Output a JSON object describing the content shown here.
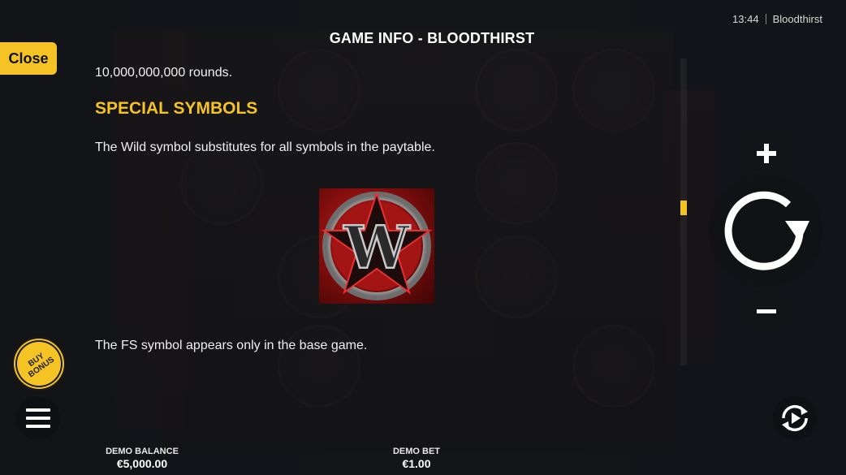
{
  "status_bar": {
    "time": "13:44",
    "game_name": "Bloodthirst"
  },
  "close_label": "Close",
  "title": "GAME INFO - BLOODTHIRST",
  "content": {
    "rounds_text": "10,000,000,000 rounds.",
    "special_symbols_heading": "SPECIAL SYMBOLS",
    "wild_text": "The Wild symbol substitutes for all symbols in the paytable.",
    "wild_symbol_letter": "W",
    "fs_text": "The FS symbol appears only in the base game."
  },
  "buy_bonus_label": "BUY BONUS",
  "demo_balance": {
    "label": "DEMO BALANCE",
    "value": "€5,000.00"
  },
  "demo_bet": {
    "label": "DEMO BET",
    "value": "€1.00"
  },
  "colors": {
    "accent": "#f5c324",
    "wild_red": "#c21c1c"
  },
  "icons": {
    "plus": "plus-icon",
    "minus": "minus-icon",
    "spin": "spin-icon",
    "menu": "menu-icon",
    "autoplay": "autoplay-icon"
  }
}
